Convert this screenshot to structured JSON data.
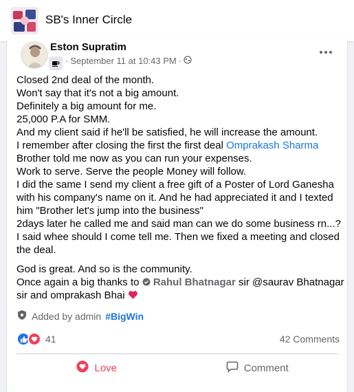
{
  "group": {
    "title": "SB's Inner Circle",
    "avatar_icon": "group-cover-thumbnail"
  },
  "post": {
    "author": "Eston Supratim",
    "date": "September 11 at 10:43 PM",
    "separator": "·",
    "badge_icon": "coffee-cup-icon",
    "audience_icon": "globe-icon",
    "body": {
      "l1": "Closed 2nd deal of the month.",
      "l2": "Won't say that it's not a big amount.",
      "l3": "Definitely a big amount for me.",
      "l4": "25,000 P.A for SMM.",
      "l5": "And my client said if he'll be satisfied, he will increase the amount.",
      "l6": "I remember after closing the first the first deal",
      "l6_mention": "Omprakash Sharma",
      "l7": "Brother told me now as you can run your expenses.",
      "l8": "Work to serve. Serve the people Money will follow.",
      "l9": "I did the same I send my client a free gift of a Poster of Lord Ganesha",
      "l10": "with his company's name on it. And he had appreciated it and I texted",
      "l11": "him \"Brother let's jump into the business\"",
      "l12": "2days later he called me and said man can we do some business rn...?",
      "l13": "I said whee should I come tell me. Then we fixed a meeting and closed",
      "l14": "the deal.",
      "l15": "God is great. And so is the community.",
      "l16": "Once again a big thanks to",
      "l16_mention": "Rahul Bhatnagar",
      "l16_tail": "sir @saurav Bhatnagar",
      "l17": "sir and omprakash  Bhai"
    },
    "added_by": "Added by admin",
    "hashtag": "#BigWin",
    "reaction_count": "41",
    "comments_count": "42 Comments",
    "actions": {
      "love": "Love",
      "comment": "Comment"
    },
    "colors": {
      "link": "#1b74e4",
      "love": "#f33e58",
      "muted": "#65676b"
    }
  }
}
